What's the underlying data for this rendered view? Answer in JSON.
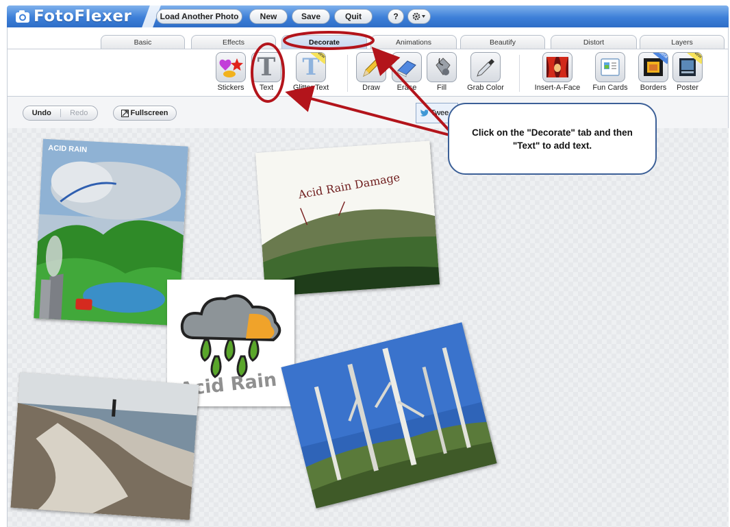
{
  "app": {
    "logo_text": "FotoFlexer",
    "buttons": {
      "load": "Load Another Photo",
      "new": "New",
      "save": "Save",
      "quit": "Quit",
      "help": "?"
    }
  },
  "tabs": [
    "Basic",
    "Effects",
    "Decorate",
    "Animations",
    "Beautify",
    "Distort",
    "Layers"
  ],
  "active_tab": "Decorate",
  "tools": {
    "stickers": "Stickers",
    "text": "Text",
    "glitter_text": "Glitter Text",
    "draw": "Draw",
    "erase": "Erase",
    "fill": "Fill",
    "grab_color": "Grab Color",
    "insert_a_face": "Insert-A-Face",
    "fun_cards": "Fun Cards",
    "borders": "Borders",
    "poster": "Poster"
  },
  "badges": {
    "new": "New",
    "beta": "Beta"
  },
  "canvas_controls": {
    "undo": "Undo",
    "redo": "Redo",
    "fullscreen": "Fullscreen",
    "tweet": "Twee"
  },
  "photos": {
    "acid_rain_diagram_title": "ACID RAIN",
    "damage_caption": "Acid Rain Damage",
    "cloud_caption": "Acid Rain"
  },
  "callout": {
    "text": "Click on the \"Decorate\" tab and then \"Text\" to add text."
  },
  "colors": {
    "topbar": "#3d7fd8",
    "annotation_red": "#b3141b",
    "callout_border": "#3b5f97"
  }
}
